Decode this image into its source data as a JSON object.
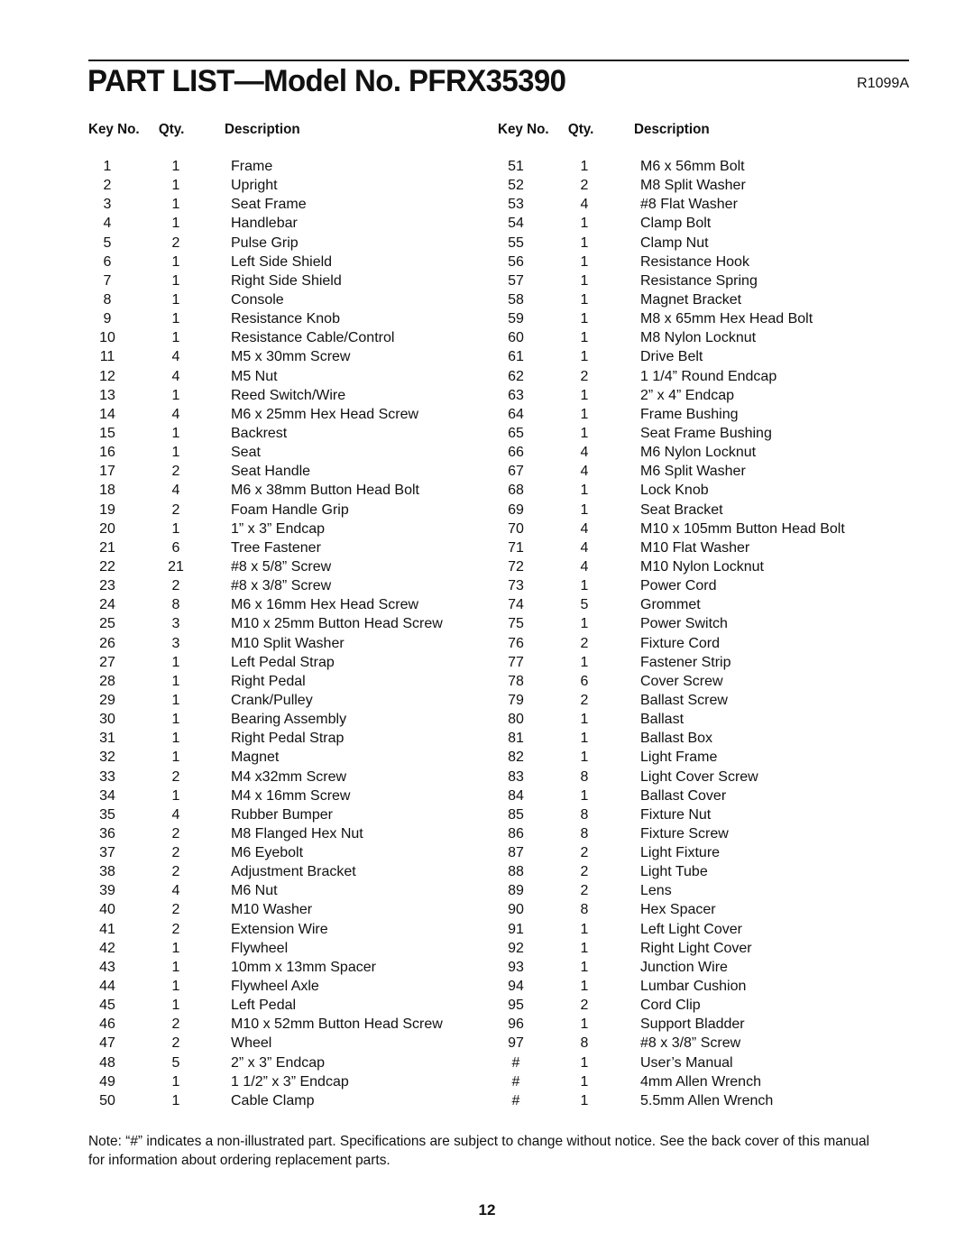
{
  "header": {
    "title": "PART LIST—Model No. PFRX35390",
    "code": "R1099A"
  },
  "columns": {
    "key": "Key No.",
    "qty": "Qty.",
    "description": "Description"
  },
  "parts_left": [
    {
      "key": "1",
      "qty": "1",
      "desc": "Frame"
    },
    {
      "key": "2",
      "qty": "1",
      "desc": "Upright"
    },
    {
      "key": "3",
      "qty": "1",
      "desc": "Seat Frame"
    },
    {
      "key": "4",
      "qty": "1",
      "desc": "Handlebar"
    },
    {
      "key": "5",
      "qty": "2",
      "desc": "Pulse Grip"
    },
    {
      "key": "6",
      "qty": "1",
      "desc": "Left Side Shield"
    },
    {
      "key": "7",
      "qty": "1",
      "desc": "Right Side Shield"
    },
    {
      "key": "8",
      "qty": "1",
      "desc": "Console"
    },
    {
      "key": "9",
      "qty": "1",
      "desc": "Resistance Knob"
    },
    {
      "key": "10",
      "qty": "1",
      "desc": "Resistance Cable/Control"
    },
    {
      "key": "11",
      "qty": "4",
      "desc": "M5 x 30mm Screw"
    },
    {
      "key": "12",
      "qty": "4",
      "desc": "M5 Nut"
    },
    {
      "key": "13",
      "qty": "1",
      "desc": "Reed Switch/Wire"
    },
    {
      "key": "14",
      "qty": "4",
      "desc": "M6 x 25mm Hex Head Screw"
    },
    {
      "key": "15",
      "qty": "1",
      "desc": "Backrest"
    },
    {
      "key": "16",
      "qty": "1",
      "desc": "Seat"
    },
    {
      "key": "17",
      "qty": "2",
      "desc": "Seat Handle"
    },
    {
      "key": "18",
      "qty": "4",
      "desc": "M6 x 38mm Button Head Bolt"
    },
    {
      "key": "19",
      "qty": "2",
      "desc": "Foam Handle Grip"
    },
    {
      "key": "20",
      "qty": "1",
      "desc": "1” x 3” Endcap"
    },
    {
      "key": "21",
      "qty": "6",
      "desc": "Tree Fastener"
    },
    {
      "key": "22",
      "qty": "21",
      "desc": "#8 x 5/8” Screw"
    },
    {
      "key": "23",
      "qty": "2",
      "desc": "#8 x 3/8” Screw"
    },
    {
      "key": "24",
      "qty": "8",
      "desc": "M6 x 16mm Hex Head Screw"
    },
    {
      "key": "25",
      "qty": "3",
      "desc": "M10 x 25mm Button Head Screw"
    },
    {
      "key": "26",
      "qty": "3",
      "desc": "M10 Split Washer"
    },
    {
      "key": "27",
      "qty": "1",
      "desc": "Left Pedal Strap"
    },
    {
      "key": "28",
      "qty": "1",
      "desc": "Right Pedal"
    },
    {
      "key": "29",
      "qty": "1",
      "desc": "Crank/Pulley"
    },
    {
      "key": "30",
      "qty": "1",
      "desc": "Bearing Assembly"
    },
    {
      "key": "31",
      "qty": "1",
      "desc": "Right Pedal Strap"
    },
    {
      "key": "32",
      "qty": "1",
      "desc": "Magnet"
    },
    {
      "key": "33",
      "qty": "2",
      "desc": "M4 x32mm Screw"
    },
    {
      "key": "34",
      "qty": "1",
      "desc": "M4 x 16mm Screw"
    },
    {
      "key": "35",
      "qty": "4",
      "desc": "Rubber Bumper"
    },
    {
      "key": "36",
      "qty": "2",
      "desc": "M8 Flanged Hex Nut"
    },
    {
      "key": "37",
      "qty": "2",
      "desc": "M6 Eyebolt"
    },
    {
      "key": "38",
      "qty": "2",
      "desc": "Adjustment Bracket"
    },
    {
      "key": "39",
      "qty": "4",
      "desc": "M6 Nut"
    },
    {
      "key": "40",
      "qty": "2",
      "desc": "M10 Washer"
    },
    {
      "key": "41",
      "qty": "2",
      "desc": "Extension Wire"
    },
    {
      "key": "42",
      "qty": "1",
      "desc": "Flywheel"
    },
    {
      "key": "43",
      "qty": "1",
      "desc": "10mm x 13mm Spacer"
    },
    {
      "key": "44",
      "qty": "1",
      "desc": "Flywheel Axle"
    },
    {
      "key": "45",
      "qty": "1",
      "desc": "Left Pedal"
    },
    {
      "key": "46",
      "qty": "2",
      "desc": "M10 x 52mm Button Head Screw"
    },
    {
      "key": "47",
      "qty": "2",
      "desc": "Wheel"
    },
    {
      "key": "48",
      "qty": "5",
      "desc": "2” x 3” Endcap"
    },
    {
      "key": "49",
      "qty": "1",
      "desc": "1 1/2” x 3” Endcap"
    },
    {
      "key": "50",
      "qty": "1",
      "desc": "Cable Clamp"
    }
  ],
  "parts_right": [
    {
      "key": "51",
      "qty": "1",
      "desc": "M6 x 56mm Bolt"
    },
    {
      "key": "52",
      "qty": "2",
      "desc": "M8 Split Washer"
    },
    {
      "key": "53",
      "qty": "4",
      "desc": "#8 Flat Washer"
    },
    {
      "key": "54",
      "qty": "1",
      "desc": "Clamp Bolt"
    },
    {
      "key": "55",
      "qty": "1",
      "desc": "Clamp Nut"
    },
    {
      "key": "56",
      "qty": "1",
      "desc": "Resistance Hook"
    },
    {
      "key": "57",
      "qty": "1",
      "desc": "Resistance Spring"
    },
    {
      "key": "58",
      "qty": "1",
      "desc": "Magnet Bracket"
    },
    {
      "key": "59",
      "qty": "1",
      "desc": "M8 x 65mm Hex Head Bolt"
    },
    {
      "key": "60",
      "qty": "1",
      "desc": "M8 Nylon Locknut"
    },
    {
      "key": "61",
      "qty": "1",
      "desc": "Drive Belt"
    },
    {
      "key": "62",
      "qty": "2",
      "desc": "1 1/4” Round Endcap"
    },
    {
      "key": "63",
      "qty": "1",
      "desc": "2” x 4” Endcap"
    },
    {
      "key": "64",
      "qty": "1",
      "desc": "Frame Bushing"
    },
    {
      "key": "65",
      "qty": "1",
      "desc": "Seat Frame Bushing"
    },
    {
      "key": "66",
      "qty": "4",
      "desc": "M6 Nylon Locknut"
    },
    {
      "key": "67",
      "qty": "4",
      "desc": "M6 Split Washer"
    },
    {
      "key": "68",
      "qty": "1",
      "desc": "Lock Knob"
    },
    {
      "key": "69",
      "qty": "1",
      "desc": "Seat Bracket"
    },
    {
      "key": "70",
      "qty": "4",
      "desc": "M10 x 105mm Button Head Bolt"
    },
    {
      "key": "71",
      "qty": "4",
      "desc": "M10 Flat Washer"
    },
    {
      "key": "72",
      "qty": "4",
      "desc": "M10 Nylon Locknut"
    },
    {
      "key": "73",
      "qty": "1",
      "desc": "Power Cord"
    },
    {
      "key": "74",
      "qty": "5",
      "desc": "Grommet"
    },
    {
      "key": "75",
      "qty": "1",
      "desc": "Power Switch"
    },
    {
      "key": "76",
      "qty": "2",
      "desc": "Fixture Cord"
    },
    {
      "key": "77",
      "qty": "1",
      "desc": "Fastener Strip"
    },
    {
      "key": "78",
      "qty": "6",
      "desc": "Cover Screw"
    },
    {
      "key": "79",
      "qty": "2",
      "desc": "Ballast Screw"
    },
    {
      "key": "80",
      "qty": "1",
      "desc": "Ballast"
    },
    {
      "key": "81",
      "qty": "1",
      "desc": "Ballast Box"
    },
    {
      "key": "82",
      "qty": "1",
      "desc": "Light Frame"
    },
    {
      "key": "83",
      "qty": "8",
      "desc": "Light Cover Screw"
    },
    {
      "key": "84",
      "qty": "1",
      "desc": "Ballast Cover"
    },
    {
      "key": "85",
      "qty": "8",
      "desc": "Fixture Nut"
    },
    {
      "key": "86",
      "qty": "8",
      "desc": "Fixture Screw"
    },
    {
      "key": "87",
      "qty": "2",
      "desc": "Light Fixture"
    },
    {
      "key": "88",
      "qty": "2",
      "desc": "Light Tube"
    },
    {
      "key": "89",
      "qty": "2",
      "desc": "Lens"
    },
    {
      "key": "90",
      "qty": "8",
      "desc": "Hex Spacer"
    },
    {
      "key": "91",
      "qty": "1",
      "desc": "Left Light Cover"
    },
    {
      "key": "92",
      "qty": "1",
      "desc": "Right Light Cover"
    },
    {
      "key": "93",
      "qty": "1",
      "desc": "Junction Wire"
    },
    {
      "key": "94",
      "qty": "1",
      "desc": "Lumbar Cushion"
    },
    {
      "key": "95",
      "qty": "2",
      "desc": "Cord Clip"
    },
    {
      "key": "96",
      "qty": "1",
      "desc": "Support Bladder"
    },
    {
      "key": "97",
      "qty": "8",
      "desc": "#8 x 3/8” Screw"
    },
    {
      "key": "#",
      "qty": "1",
      "desc": "User’s Manual"
    },
    {
      "key": "#",
      "qty": "1",
      "desc": "4mm Allen Wrench"
    },
    {
      "key": "#",
      "qty": "1",
      "desc": "5.5mm Allen Wrench"
    }
  ],
  "footer": {
    "note": "Note: “#” indicates a non-illustrated part. Specifications are subject to change without notice. See the back cover of this manual for information about ordering replacement parts.",
    "page_number": "12"
  }
}
